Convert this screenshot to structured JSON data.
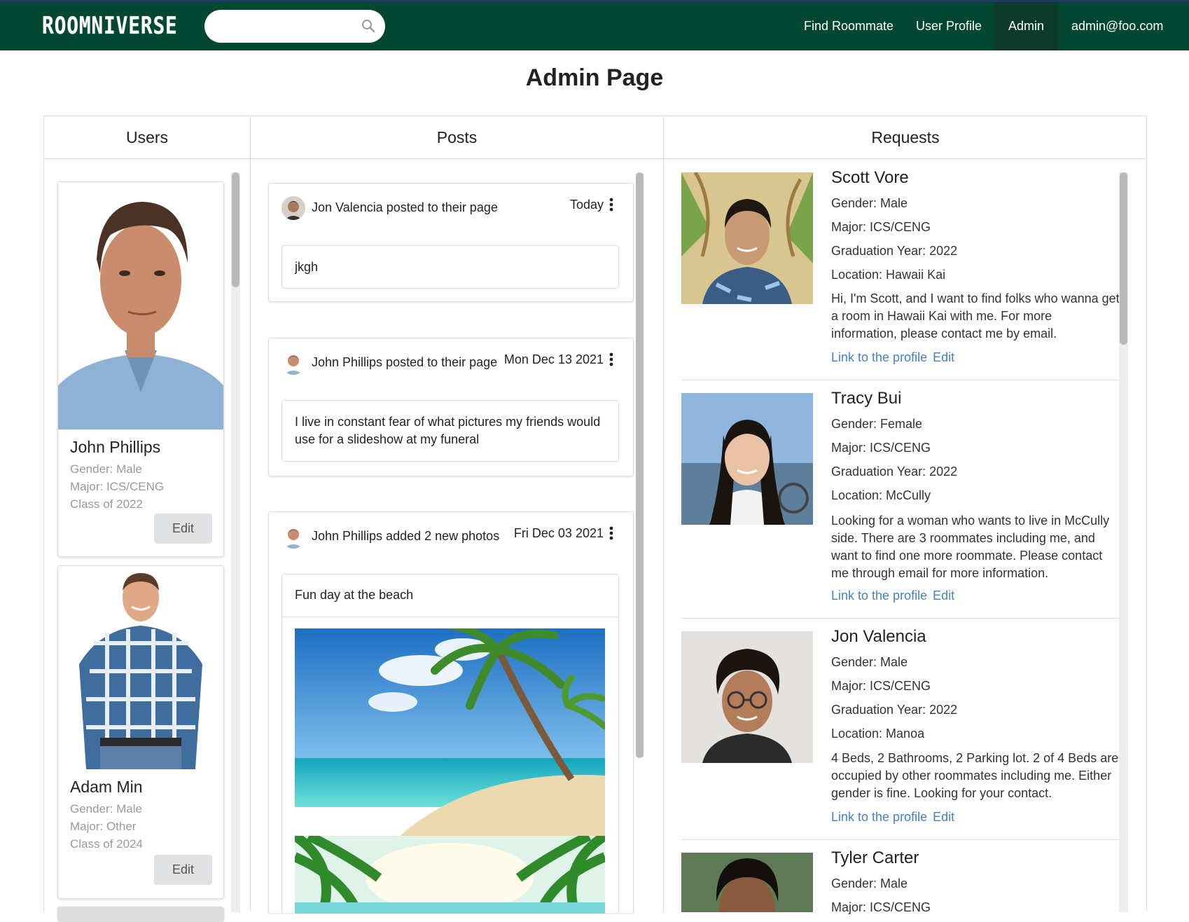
{
  "nav": {
    "logo": "ROOMNIVERSE",
    "search_placeholder": "",
    "items": [
      "Find Roommate",
      "User Profile",
      "Admin",
      "admin@foo.com"
    ]
  },
  "page": {
    "title": "Admin Page"
  },
  "columns": {
    "users": "Users",
    "posts": "Posts",
    "requests": "Requests"
  },
  "users": [
    {
      "name": "John Phillips",
      "gender": "Gender: Male",
      "major": "Major: ICS/CENG",
      "class": "Class of 2022",
      "edit": "Edit"
    },
    {
      "name": "Adam Min",
      "gender": "Gender: Male",
      "major": "Major: Other",
      "class": "Class of 2024",
      "edit": "Edit"
    }
  ],
  "posts": [
    {
      "author": "Jon Valencia posted to their page",
      "date": "Today",
      "body": "jkgh"
    },
    {
      "author": "John Phillips posted to their page",
      "date": "Mon Dec 13 2021",
      "body": "I live in constant fear of what pictures my friends would use for a slideshow at my funeral"
    },
    {
      "author": "John Phillips added 2 new photos",
      "date": "Fri Dec 03 2021",
      "body": "Fun day at the beach"
    }
  ],
  "requests": [
    {
      "name": "Scott Vore",
      "gender": "Gender: Male",
      "major": "Major: ICS/CENG",
      "grad": "Graduation Year: 2022",
      "location": "Location: Hawaii Kai",
      "desc": "Hi, I'm Scott, and I want to find folks who wanna get a room in Hawaii Kai with me. For more information, please contact me by email.",
      "link": "Link to the profile",
      "edit": "Edit"
    },
    {
      "name": "Tracy Bui",
      "gender": "Gender: Female",
      "major": "Major: ICS/CENG",
      "grad": "Graduation Year: 2022",
      "location": "Location: McCully",
      "desc": "Looking for a woman who wants to live in McCully side. There are 3 roommates including me, and want to find one more roommate. Please contact me through email for more information.",
      "link": "Link to the profile",
      "edit": "Edit"
    },
    {
      "name": "Jon Valencia",
      "gender": "Gender: Male",
      "major": "Major: ICS/CENG",
      "grad": "Graduation Year: 2022",
      "location": "Location: Manoa",
      "desc": "4 Beds, 2 Bathrooms, 2 Parking lot. 2 of 4 Beds are occupied by other roommates including me. Either gender is fine. Looking for your contact.",
      "link": "Link to the profile",
      "edit": "Edit"
    },
    {
      "name": "Tyler Carter",
      "gender": "Gender: Male",
      "major": "Major: ICS/CENG"
    }
  ],
  "colors": {
    "nav_bg": "#024731",
    "link": "#4183c4",
    "button_bg": "#e0e1e2"
  }
}
